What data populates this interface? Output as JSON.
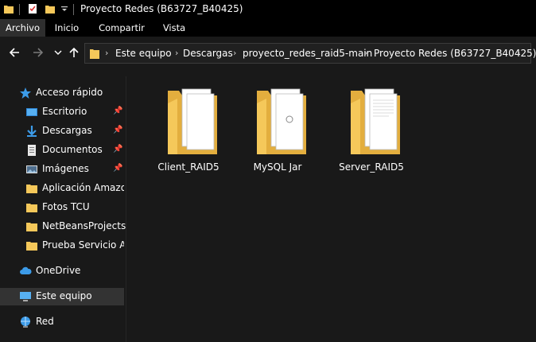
{
  "window": {
    "title": "Proyecto Redes (B63727_B40425)"
  },
  "quick_access_toolbar": {
    "icons": [
      "folder-icon",
      "properties-icon",
      "new-folder-icon",
      "dropdown-arrow-icon"
    ]
  },
  "ribbon": {
    "tabs": [
      {
        "label": "Archivo",
        "active": true
      },
      {
        "label": "Inicio",
        "active": false
      },
      {
        "label": "Compartir",
        "active": false
      },
      {
        "label": "Vista",
        "active": false
      }
    ]
  },
  "navigation": {
    "breadcrumbs": [
      "Este equipo",
      "Descargas",
      "proyecto_redes_raid5-main",
      "Proyecto Redes (B63727_B40425)"
    ]
  },
  "sidebar": {
    "quick_access_label": "Acceso rápido",
    "items": [
      {
        "label": "Escritorio",
        "icon": "desktop-icon",
        "pinned": true
      },
      {
        "label": "Descargas",
        "icon": "download-icon",
        "pinned": true
      },
      {
        "label": "Documentos",
        "icon": "documents-icon",
        "pinned": true
      },
      {
        "label": "Imágenes",
        "icon": "pictures-icon",
        "pinned": true
      },
      {
        "label": "Aplicación Amazon",
        "icon": "folder-icon",
        "pinned": false
      },
      {
        "label": "Fotos TCU",
        "icon": "folder-icon",
        "pinned": false
      },
      {
        "label": "NetBeansProjects",
        "icon": "folder-icon",
        "pinned": false
      },
      {
        "label": "Prueba Servicio Al C",
        "icon": "folder-icon",
        "pinned": false
      }
    ],
    "onedrive_label": "OneDrive",
    "this_pc_label": "Este equipo",
    "network_label": "Red"
  },
  "folders": [
    {
      "name": "Client_RAID5"
    },
    {
      "name": "MySQL Jar"
    },
    {
      "name": "Server_RAID5"
    }
  ],
  "colors": {
    "background": "#191919",
    "titlebar": "#000000",
    "folder_yellow": "#F5C85A",
    "selected": "#333333",
    "accent_blue": "#3C9BE8"
  }
}
